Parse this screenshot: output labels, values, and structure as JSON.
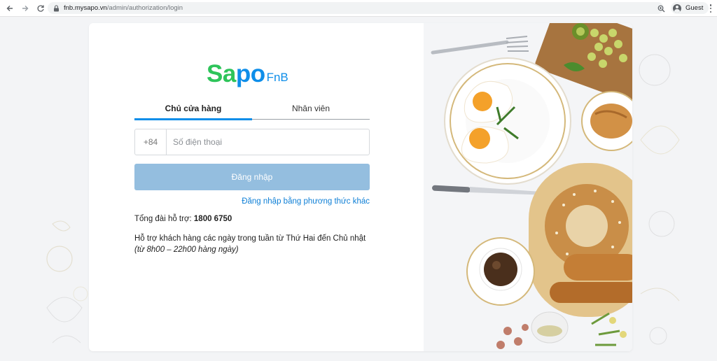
{
  "browser": {
    "url_host": "fnb.mysapo.vn",
    "url_path": "/admin/authorization/login",
    "profile_label": "Guest"
  },
  "brand": {
    "logo_main_green": "Sa",
    "logo_main_blue": "po",
    "logo_sub": "FnB",
    "green": "#2ec45a",
    "blue": "#0e8ee9"
  },
  "login": {
    "tabs": [
      {
        "label": "Chủ cửa hàng",
        "active": true
      },
      {
        "label": "Nhân viên",
        "active": false
      }
    ],
    "country_code": "+84",
    "phone_placeholder": "Số điện thoại",
    "phone_value": "",
    "submit_label": "Đăng nhập",
    "alt_login_link": "Đăng nhập bằng phương thức khác",
    "hotline_label": "Tổng đài hỗ trợ: ",
    "hotline_number": "1800 6750",
    "support_text": "Hỗ trợ khách hàng các ngày trong tuần từ Thứ Hai đến Chủ nhật",
    "support_hours": "(từ 8h00 – 22h00 hàng ngày)",
    "button_color": "#94bedf"
  },
  "icons": {
    "back": "arrow-left-icon",
    "forward": "arrow-right-icon",
    "reload": "reload-icon",
    "lock": "lock-icon",
    "zoom": "zoom-icon",
    "profile": "avatar-icon",
    "menu": "more-vertical-icon"
  }
}
